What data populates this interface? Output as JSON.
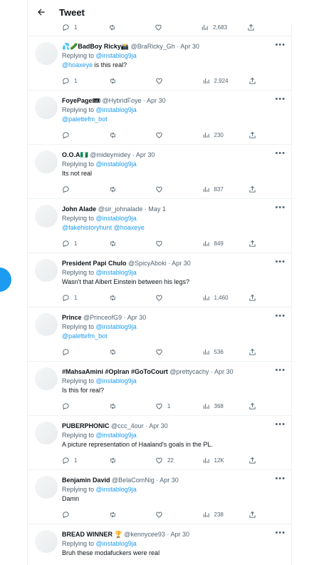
{
  "header": {
    "title": "Tweet"
  },
  "top_actions": {
    "replies": "1",
    "retweets": "",
    "likes": "",
    "views": "2,683"
  },
  "replies": [
    {
      "name": "💦🥒BadBoy Ricky📸",
      "handle": "@BraRicky_Gh",
      "date": "Apr 30",
      "replying_label": "Replying to",
      "replying_to": "@instablog9ja",
      "text_mention": "@hoaxeye",
      "text": " is this real?",
      "replies": "1",
      "retweets": "",
      "likes": "",
      "views": "2,924"
    },
    {
      "name": "FoyePage🎟",
      "handle": "@HybridFoye",
      "date": "Apr 30",
      "replying_label": "Replying to",
      "replying_to": "@instablog9ja",
      "text_mention": "@palettefm_bot",
      "text": "",
      "replies": "",
      "retweets": "",
      "likes": "",
      "views": "230"
    },
    {
      "name": "O.O.A🇳🇬",
      "handle": "@mideymidey",
      "date": "Apr 30",
      "replying_label": "Replying to",
      "replying_to": "@instablog9ja",
      "text_mention": "",
      "text": "Its not real",
      "replies": "",
      "retweets": "",
      "likes": "",
      "views": "837"
    },
    {
      "name": "John Alade",
      "handle": "@sir_johnalade",
      "date": "May 1",
      "replying_label": "Replying to",
      "replying_to": "@instablog9ja",
      "text_mention": "@fakehistoryhunt @hoaxeye",
      "text": "",
      "replies": "1",
      "retweets": "",
      "likes": "",
      "views": "849"
    },
    {
      "name": "President Papi Chulo",
      "handle": "@SpicyAboki",
      "date": "Apr 30",
      "replying_label": "Replying to",
      "replying_to": "@instablog9ja",
      "text_mention": "",
      "text": "Wasn't that Albert Einstein between his legs?",
      "replies": "1",
      "retweets": "",
      "likes": "",
      "views": "1,460"
    },
    {
      "name": "Prince",
      "handle": "@PrinceofG9",
      "date": "Apr 30",
      "replying_label": "Replying to",
      "replying_to": "@instablog9ja",
      "text_mention": "@palettefm_bot",
      "text": "",
      "replies": "",
      "retweets": "",
      "likes": "",
      "views": "536"
    },
    {
      "name": "#MahsaAmini #OpIran #GoToCourt",
      "handle": "@prettycachy",
      "date": "Apr 30",
      "replying_label": "Replying to",
      "replying_to": "@instablog9ja",
      "text_mention": "",
      "text": "Is this for real?",
      "replies": "",
      "retweets": "",
      "likes": "1",
      "views": "368"
    },
    {
      "name": "PUBERPHONIC",
      "handle": "@ccc_4our",
      "date": "Apr 30",
      "replying_label": "Replying to",
      "replying_to": "@instablog9ja",
      "text_mention": "",
      "text": "A picture representation of Haaland's goals in the PL.",
      "replies": "1",
      "retweets": "",
      "likes": "22",
      "views": "12K"
    },
    {
      "name": "Benjamin David",
      "handle": "@BelaComNig",
      "date": "Apr 30",
      "replying_label": "Replying to",
      "replying_to": "@instablog9ja",
      "text_mention": "",
      "text": "Damn",
      "replies": "",
      "retweets": "",
      "likes": "",
      "views": "238"
    },
    {
      "name": "BREAD WINNER 🏆",
      "handle": "@kennycee93",
      "date": "Apr 30",
      "replying_label": "Replying to",
      "replying_to": "@instablog9ja",
      "text_mention": "",
      "text": "Bruh these modafuckers were real",
      "replies": "",
      "retweets": "",
      "likes": "",
      "views": ""
    }
  ],
  "colors": {
    "accent": "#1d9bf0",
    "muted": "#536471",
    "text": "#0f1419",
    "border": "#eff3f4"
  },
  "icons": {
    "back": "arrow-left-icon",
    "reply": "comment-icon",
    "retweet": "retweet-icon",
    "like": "heart-icon",
    "views": "bar-chart-icon",
    "share": "share-icon",
    "more": "more-icon"
  }
}
